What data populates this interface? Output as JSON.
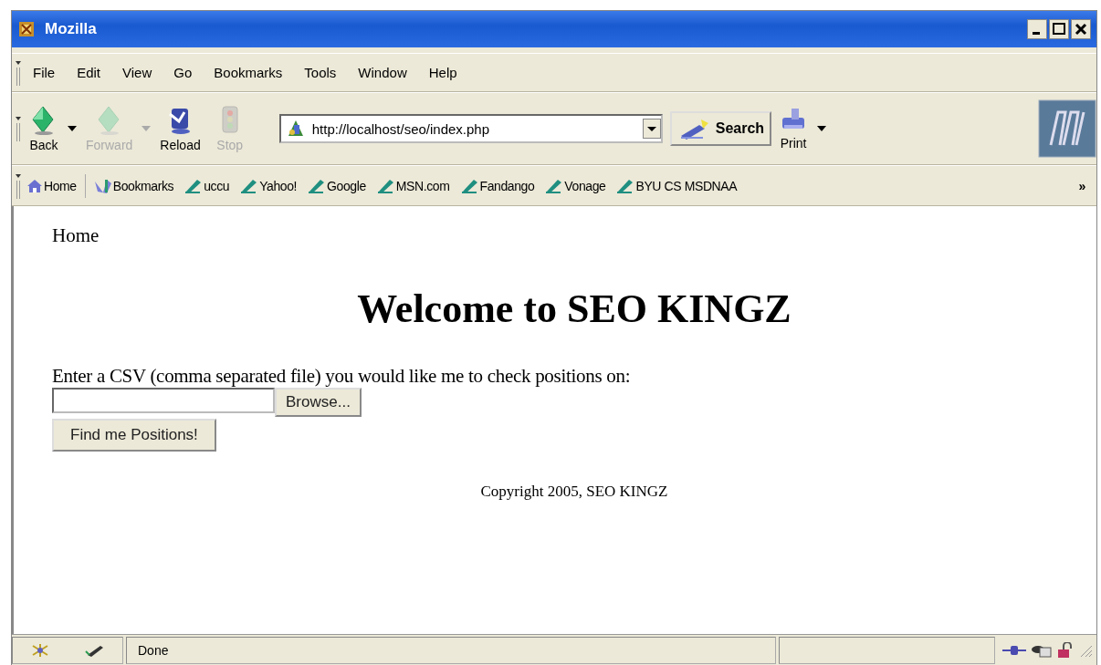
{
  "window": {
    "title": "Mozilla"
  },
  "menu": [
    "File",
    "Edit",
    "View",
    "Go",
    "Bookmarks",
    "Tools",
    "Window",
    "Help"
  ],
  "toolbar": {
    "buttons": [
      {
        "kind": "back",
        "label": "Back",
        "disabled": false,
        "dropdown": true
      },
      {
        "kind": "forward",
        "label": "Forward",
        "disabled": true,
        "dropdown": true
      },
      {
        "kind": "reload",
        "label": "Reload",
        "disabled": false,
        "dropdown": false
      },
      {
        "kind": "stop",
        "label": "Stop",
        "disabled": true,
        "dropdown": false
      }
    ],
    "address": "http://localhost/seo/index.php",
    "search": "Search",
    "print": "Print"
  },
  "bookmarks": {
    "items": [
      {
        "kind": "home",
        "label": "Home"
      },
      {
        "kind": "folder",
        "label": "Bookmarks"
      },
      {
        "kind": "link",
        "label": "uccu"
      },
      {
        "kind": "link",
        "label": "Yahoo!"
      },
      {
        "kind": "link",
        "label": "Google"
      },
      {
        "kind": "link",
        "label": "MSN.com"
      },
      {
        "kind": "link",
        "label": "Fandango"
      },
      {
        "kind": "link",
        "label": "Vonage"
      },
      {
        "kind": "link",
        "label": "BYU CS MSDNAA"
      }
    ],
    "more": "»"
  },
  "page": {
    "nav": "Home",
    "heading": "Welcome to SEO KINGZ",
    "prompt": "Enter a CSV (comma separated file) you would like me to check positions on:",
    "browse": "Browse...",
    "submit": "Find me Positions!",
    "footer": "Copyright 2005, SEO KINGZ"
  },
  "status_bar": {
    "text": "Done"
  }
}
